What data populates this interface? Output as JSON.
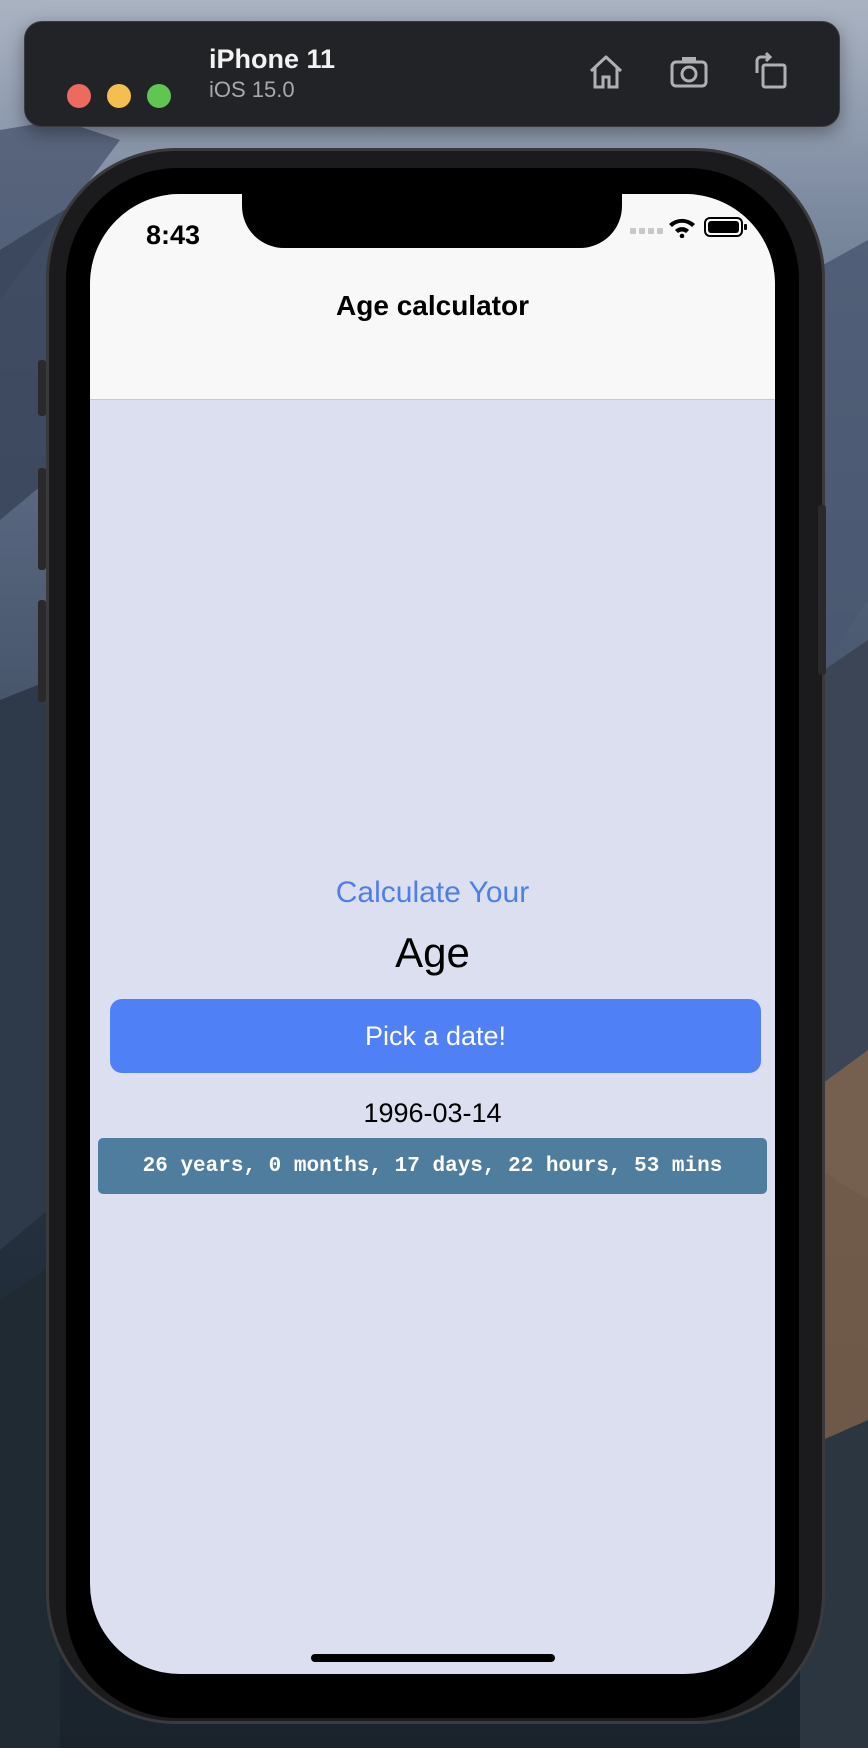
{
  "simulator": {
    "device_name": "iPhone 11",
    "os_version": "iOS 15.0",
    "traffic_lights": {
      "close": "#ec6a5e",
      "minimize": "#f4bf4f",
      "zoom": "#61c554"
    },
    "toolbar_icons": [
      "home-icon",
      "screenshot-icon",
      "rotate-icon"
    ]
  },
  "status_bar": {
    "time": "8:43",
    "icons": [
      "cellular-dots-icon",
      "wifi-icon",
      "battery-icon"
    ]
  },
  "nav": {
    "title": "Age calculator"
  },
  "main": {
    "heading_line1": "Calculate Your",
    "heading_line2": "Age",
    "pick_button_label": "Pick a date!",
    "selected_date": "1996-03-14",
    "result": "26 years, 0 months, 17 days, 22 hours, 53 mins"
  },
  "colors": {
    "accent_blue": "#4f80f5",
    "heading_blue": "#4f7fe6",
    "result_bg": "#4f7d9d",
    "screen_bg": "#dcdff0"
  }
}
